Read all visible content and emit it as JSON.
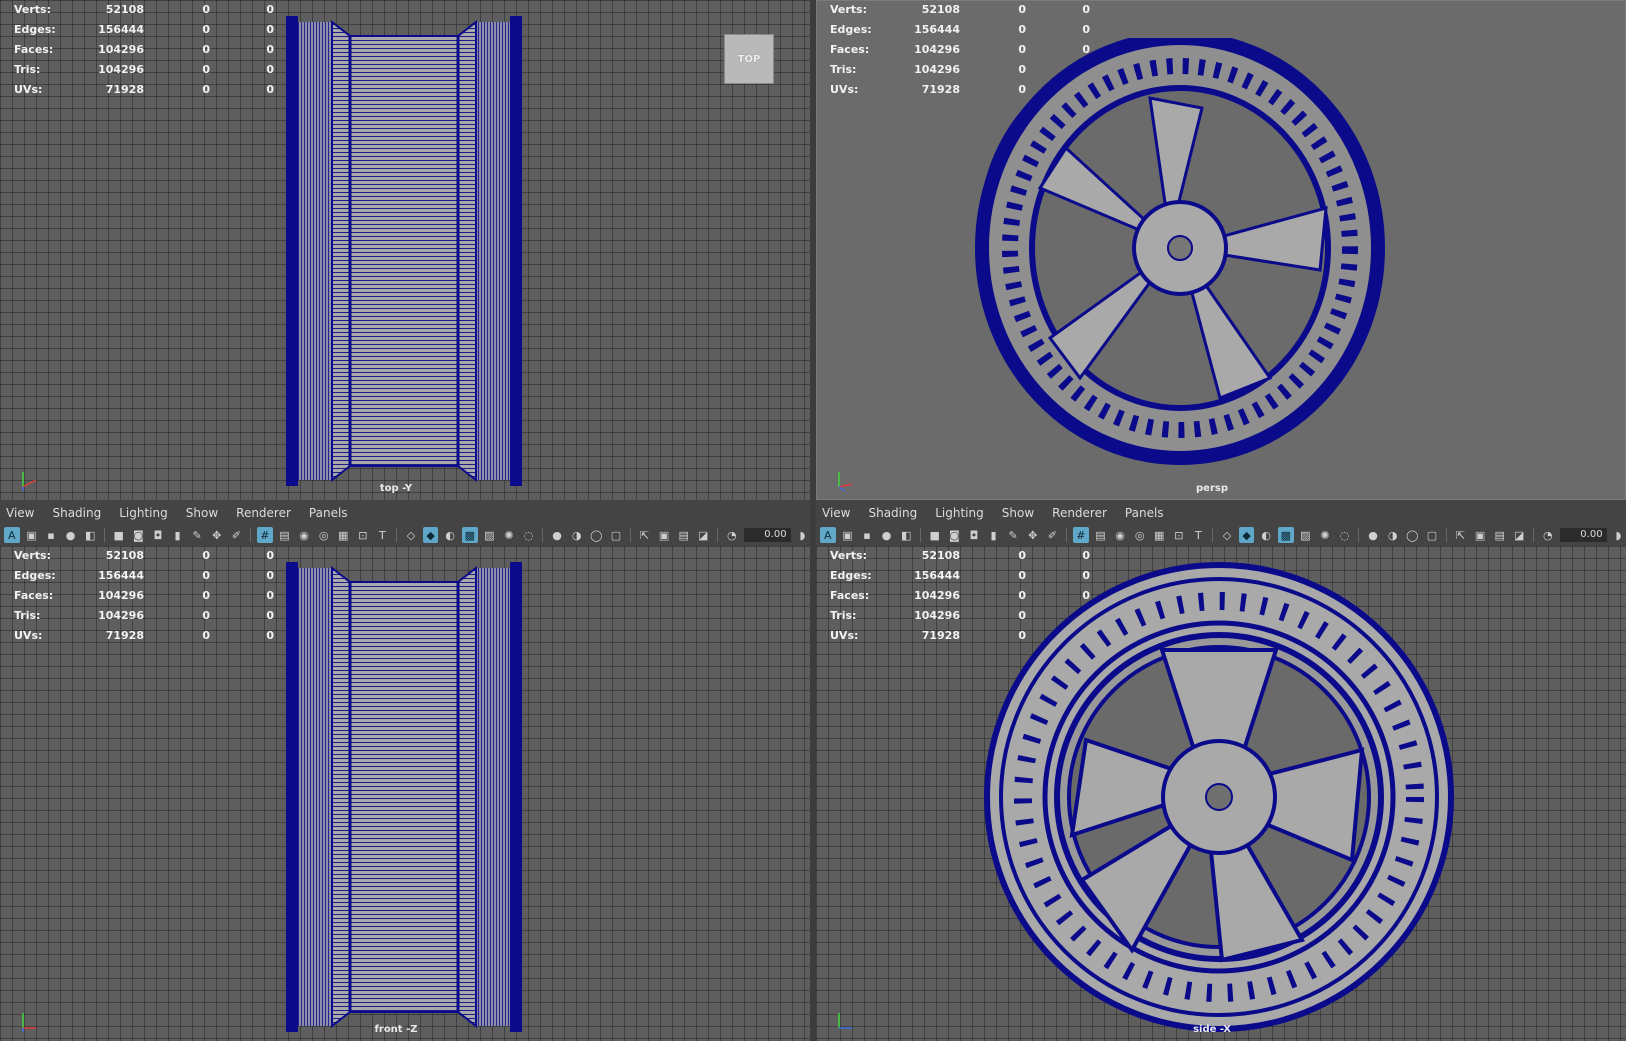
{
  "stats": {
    "rows": [
      {
        "label": "Verts:",
        "v1": "52108",
        "v2": "0",
        "v3": "0"
      },
      {
        "label": "Edges:",
        "v1": "156444",
        "v2": "0",
        "v3": "0"
      },
      {
        "label": "Faces:",
        "v1": "104296",
        "v2": "0",
        "v3": "0"
      },
      {
        "label": "Tris:",
        "v1": "104296",
        "v2": "0",
        "v3": "0"
      },
      {
        "label": "UVs:",
        "v1": "71928",
        "v2": "0",
        "v3": "0"
      }
    ]
  },
  "viewports": {
    "top": {
      "camera": "top -Y",
      "cube": "TOP"
    },
    "persp": {
      "camera": "persp"
    },
    "front": {
      "camera": "front -Z"
    },
    "side": {
      "camera": "side -X"
    }
  },
  "menus": [
    "View",
    "Shading",
    "Lighting",
    "Show",
    "Renderer",
    "Panels"
  ],
  "toolbar": {
    "exposure": "0.00"
  },
  "colors": {
    "wire": "#0a0a8a",
    "mesh": "#a8a8a8",
    "grid_bg": "#5e5e5e"
  }
}
